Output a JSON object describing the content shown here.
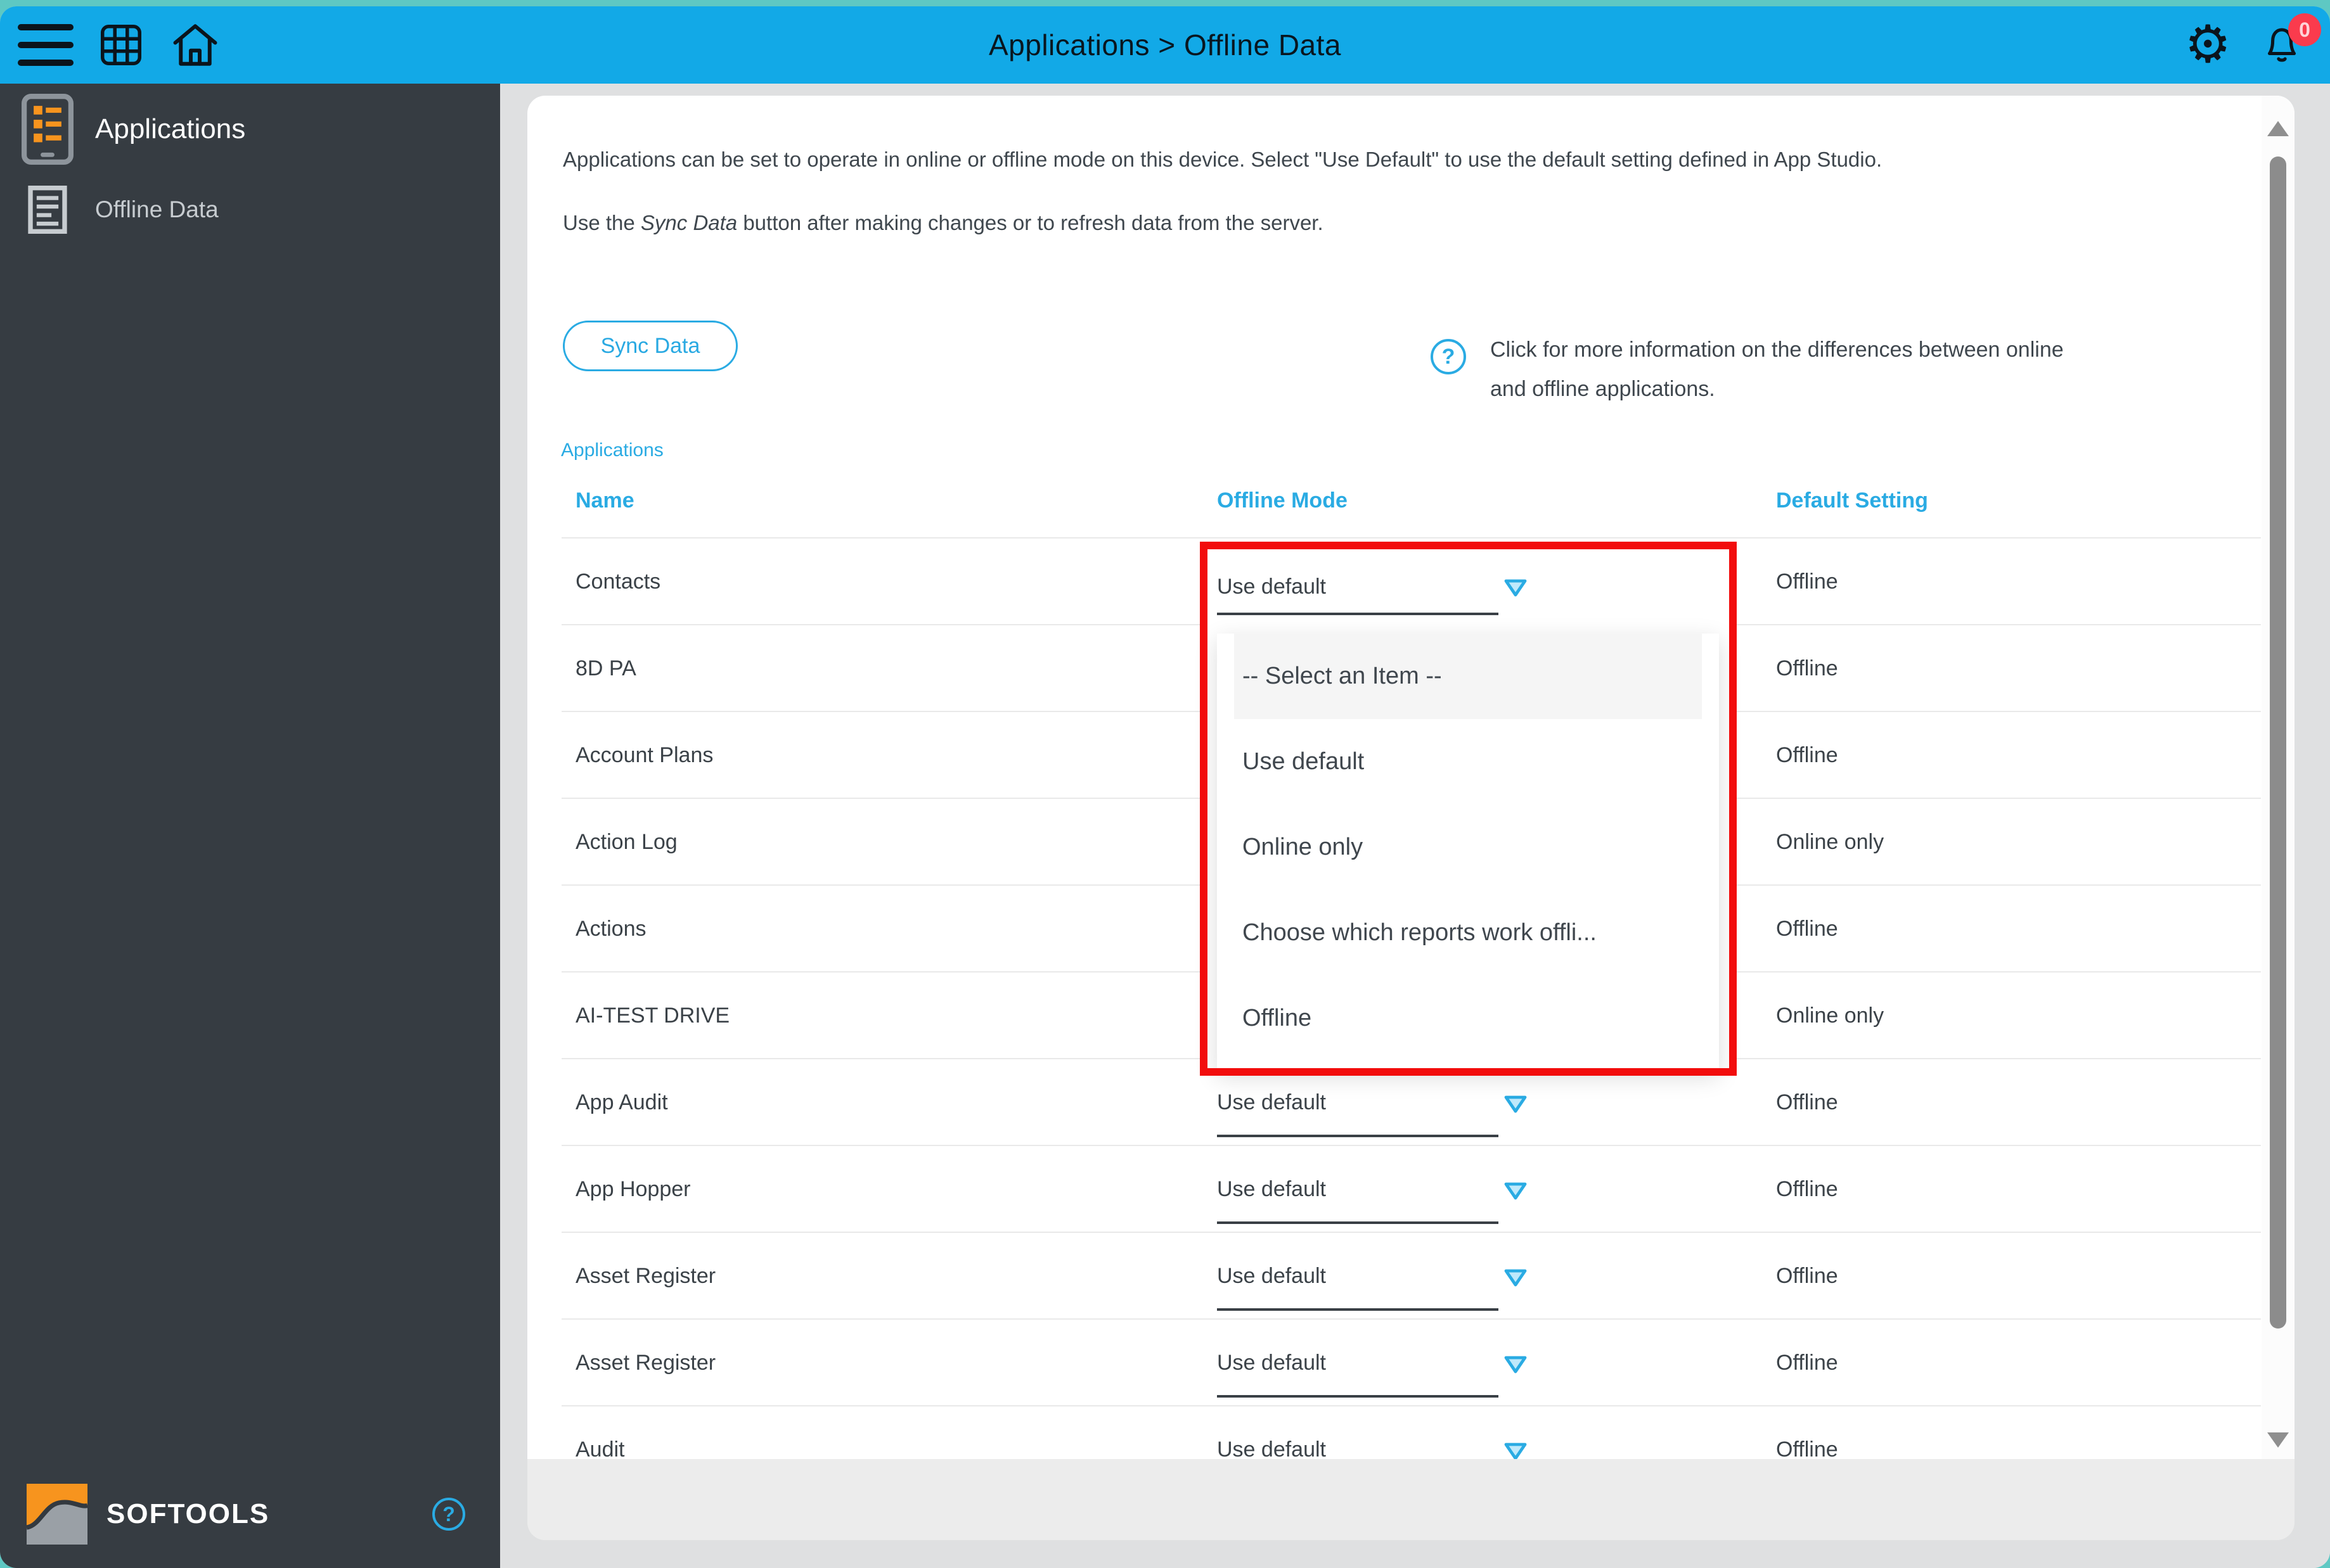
{
  "topbar": {
    "title": "Applications > Offline Data",
    "notification_count": "0"
  },
  "sidebar": {
    "items": [
      {
        "label": "Applications"
      },
      {
        "label": "Offline Data"
      }
    ],
    "logo_text": "SOFTOOLS"
  },
  "content": {
    "intro_line1": "Applications can be set to operate in online or offline mode on this device. Select \"Use Default\" to use the default setting defined in App Studio.",
    "intro_line2_prefix": "Use the ",
    "intro_line2_italic": "Sync Data",
    "intro_line2_suffix": " button after making changes or to refresh data from the server.",
    "sync_button_label": "Sync Data",
    "help_icon": "?",
    "help_text_line1": "Click for more information on the differences between online",
    "help_text_line2": "and offline applications.",
    "section_label": "Applications",
    "table": {
      "columns": [
        "Name",
        "Offline Mode",
        "Default Setting"
      ],
      "rows": [
        {
          "name": "Contacts",
          "offline_mode": "Use default",
          "show_select": true,
          "default_setting": "Offline"
        },
        {
          "name": "8D PA",
          "show_select": false,
          "default_setting": "Offline"
        },
        {
          "name": "Account Plans",
          "show_select": false,
          "default_setting": "Offline"
        },
        {
          "name": "Action Log",
          "show_select": false,
          "default_setting": "Online only"
        },
        {
          "name": "Actions",
          "show_select": false,
          "default_setting": "Offline"
        },
        {
          "name": "AI-TEST DRIVE",
          "show_select": false,
          "default_setting": "Online only"
        },
        {
          "name": "App Audit",
          "offline_mode": "Use default",
          "show_select": true,
          "default_setting": "Offline"
        },
        {
          "name": "App Hopper",
          "offline_mode": "Use default",
          "show_select": true,
          "default_setting": "Offline"
        },
        {
          "name": "Asset Register",
          "offline_mode": "Use default",
          "show_select": true,
          "default_setting": "Offline"
        },
        {
          "name": "Asset Register",
          "offline_mode": "Use default",
          "show_select": true,
          "default_setting": "Offline"
        },
        {
          "name": "Audit",
          "offline_mode": "Use default",
          "show_select": true,
          "default_setting": "Offline"
        }
      ]
    },
    "dropdown": {
      "options": [
        "-- Select an Item --",
        "Use default",
        "Online only",
        "Choose which reports work offli...",
        "Offline"
      ],
      "highlighted": "-- Select an Item --"
    }
  },
  "colors": {
    "topbar_blue": "#12a9e7",
    "page_teal": "#5ec8c3",
    "sidebar_dark": "#363c42",
    "accent_blue": "#2aabe3",
    "annotation_red": "#f20d0d",
    "badge_red": "#fa3b4d",
    "logo_orange": "#f7941e"
  }
}
